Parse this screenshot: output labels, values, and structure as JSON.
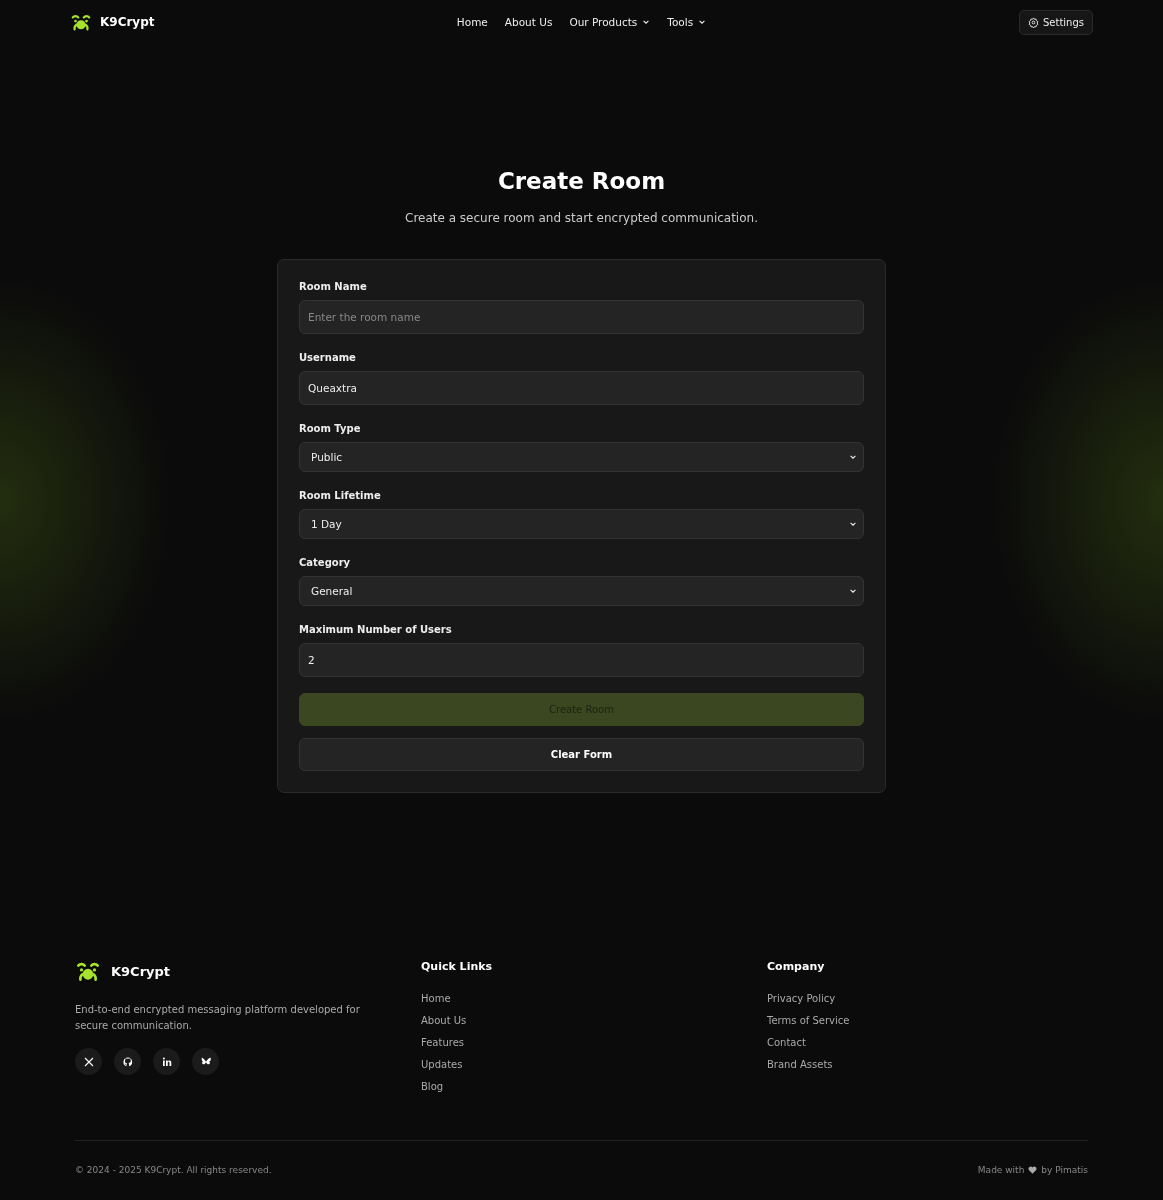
{
  "header": {
    "brand": "K9Crypt",
    "nav": [
      {
        "label": "Home",
        "dropdown": false
      },
      {
        "label": "About Us",
        "dropdown": false
      },
      {
        "label": "Our Products",
        "dropdown": true
      },
      {
        "label": "Tools",
        "dropdown": true
      }
    ],
    "settings_button": "Settings"
  },
  "page": {
    "title": "Create Room",
    "subtitle": "Create a secure room and start encrypted communication."
  },
  "form": {
    "fields": [
      {
        "kind": "text",
        "label": "Room Name",
        "placeholder": "Enter the room name"
      },
      {
        "kind": "text",
        "label": "Username",
        "value": "Queaxtra"
      },
      {
        "kind": "select",
        "label": "Room Type",
        "value": "Public"
      },
      {
        "kind": "select",
        "label": "Room Lifetime",
        "value": "1 Day"
      },
      {
        "kind": "select",
        "label": "Category",
        "value": "General"
      },
      {
        "kind": "text",
        "label": "Maximum Number of Users",
        "value": "2"
      }
    ],
    "submit_button": {
      "label": "Create Room",
      "disabled": true
    },
    "clear_button": "Clear Form"
  },
  "footer": {
    "brand": "K9Crypt",
    "description": "End-to-end encrypted messaging platform developed for secure communication.",
    "social": [
      {
        "kind": "x"
      },
      {
        "kind": "github"
      },
      {
        "kind": "linkedin"
      },
      {
        "kind": "bluesky"
      }
    ],
    "columns": [
      {
        "title": "Quick Links",
        "links": [
          "Home",
          "About Us",
          "Features",
          "Updates",
          "Blog"
        ]
      },
      {
        "title": "Company",
        "links": [
          "Privacy Policy",
          "Terms of Service",
          "Contact",
          "Brand Assets"
        ]
      }
    ],
    "copyright": "© 2024 - 2025 K9Crypt. All rights reserved.",
    "made_with": "Made with",
    "made_by": "by Pimatis"
  }
}
